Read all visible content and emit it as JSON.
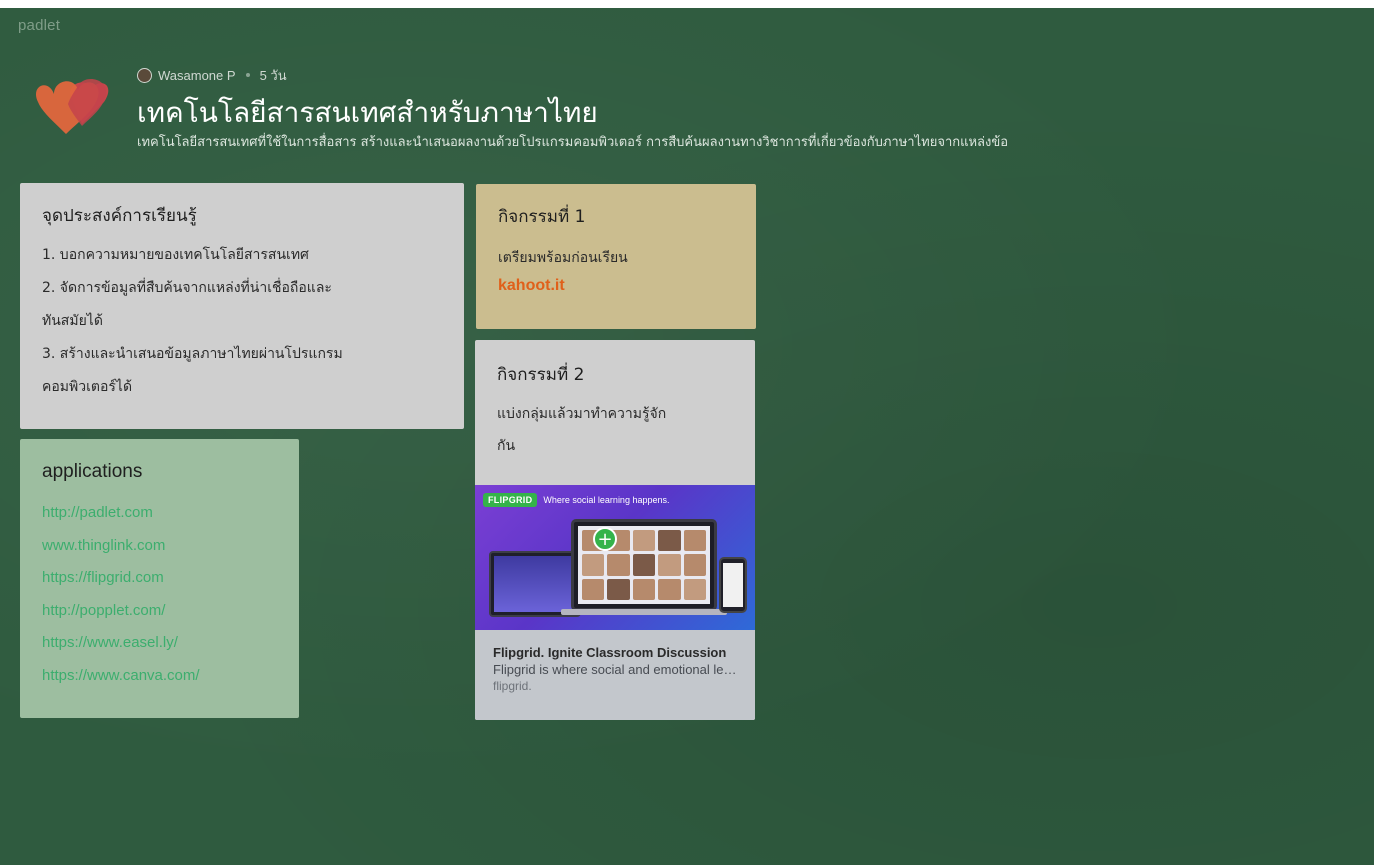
{
  "app": {
    "brand": "padlet"
  },
  "board": {
    "author": "Wasamone P",
    "time_ago": "5 วัน",
    "title": "เทคโนโลยีสารสนเทศสำหรับภาษาไทย",
    "description": "เทคโนโลยีสารสนเทศที่ใช้ในการสื่อสาร สร้างและนำเสนอผลงานด้วยโปรแกรมคอมพิวเตอร์ การสืบค้นผลงานทางวิชาการที่เกี่ยวข้องกับภาษาไทยจากแหล่งข้อ"
  },
  "posts": {
    "objectives": {
      "title": "จุดประสงค์การเรียนรู้",
      "lines": [
        "1. บอกความหมายของเทคโนโลยีสารสนเทศ",
        "2. จัดการข้อมูลที่สืบค้นจากแหล่งที่น่าเชื่อถือและ",
        "ทันสมัยได้",
        "3. สร้างและนำเสนอข้อมูลภาษาไทยผ่านโปรแกรม",
        "คอมพิวเตอร์ได้"
      ],
      "color": "#cfcfcf"
    },
    "applications": {
      "title": "applications",
      "links": [
        "http://padlet.com",
        "www.thinglink.com",
        "https://flipgrid.com",
        "http://popplet.com/",
        "https://www.easel.ly/",
        "https://www.canva.com/"
      ],
      "color": "#9dbea0"
    },
    "activity1": {
      "title": "กิจกรรมที่ 1",
      "body": "เตรียมพร้อมก่อนเรียน",
      "link": "kahoot.it",
      "color": "#cbbd8f"
    },
    "activity2": {
      "title": "กิจกรรมที่ 2",
      "body_lines": [
        "แบ่งกลุ่มแล้วมาทำความรู้จัก",
        "กัน"
      ],
      "preview": {
        "image_logo": "FLIPGRID",
        "image_tagline": "Where social learning happens.",
        "title": "Flipgrid. Ignite Classroom Discussion",
        "description": "Flipgrid is where social and emotional learning happens",
        "source": "flipgrid."
      },
      "color": "#cfcfcf"
    }
  },
  "colors": {
    "background": "#2f5b3f",
    "link_green": "#3cae6e",
    "link_orange": "#e0601a"
  },
  "icons": {
    "logo": "hearts-icon",
    "avatar": "user-avatar-icon",
    "plus": "plus-icon"
  }
}
